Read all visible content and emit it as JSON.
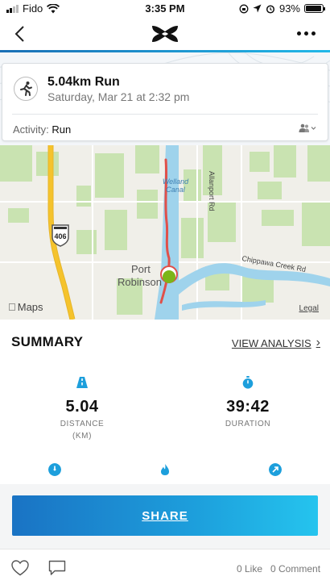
{
  "status_bar": {
    "carrier": "Fido",
    "time": "3:35 PM",
    "battery": "93%",
    "battery_level": 0.93,
    "icons": [
      "signal-icon",
      "wifi-icon",
      "lock-rotation-icon",
      "location-arrow-icon",
      "alarm-icon",
      "battery-icon"
    ]
  },
  "nav": {
    "back_icon": "chevron-left-icon",
    "logo": "under-armour-logo",
    "more_icon": "more-dots-icon"
  },
  "workout": {
    "icon": "running-person-icon",
    "title": "5.04km Run",
    "date": "Saturday, Mar 21 at 2:32 pm",
    "activity_label": "Activity:",
    "activity_value": "Run",
    "privacy_icon": "friends-privacy-icon"
  },
  "map": {
    "labels": {
      "water": "Welland\nCanal",
      "road": "Allanport Rd",
      "town_line1": "Port",
      "town_line2": "Robinson",
      "creek": "Chippawa Creek Rd",
      "shield": "406"
    },
    "provider": "Maps",
    "legal": "Legal",
    "colors": {
      "route": "#e0504a",
      "marker": "#7cb518",
      "water": "#9fd3ec",
      "highway": "#f5c32c"
    }
  },
  "summary": {
    "title": "SUMMARY",
    "view_analysis": "VIEW ANALYSIS",
    "stats": [
      {
        "icon": "road-icon",
        "value": "5.04",
        "label": "DISTANCE",
        "unit": "(KM)"
      },
      {
        "icon": "stopwatch-icon",
        "value": "39:42",
        "label": "DURATION",
        "unit": ""
      }
    ],
    "more_icons": [
      "pace-gauge-icon",
      "flame-calories-icon",
      "speed-arrow-icon"
    ]
  },
  "share": {
    "label": "SHARE"
  },
  "social": {
    "like_icon": "heart-icon",
    "comment_icon": "comment-bubble-icon",
    "likes": "0 Like",
    "comments": "0 Comment"
  },
  "accent_color": "#1d9fdc"
}
